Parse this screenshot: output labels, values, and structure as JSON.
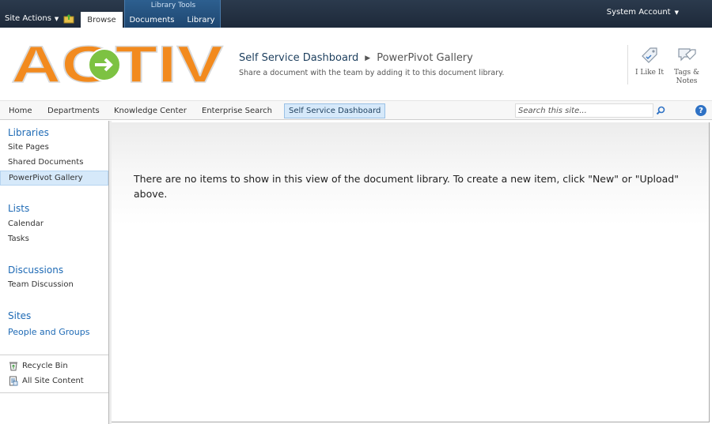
{
  "ribbon": {
    "site_actions": "Site Actions",
    "tabs": {
      "browse": "Browse",
      "documents": "Documents",
      "library": "Library"
    },
    "contextual_group": "Library Tools",
    "account": "System Account"
  },
  "header": {
    "logo_text": "AGTIV",
    "breadcrumb": {
      "site": "Self Service Dashboard",
      "current": "PowerPivot Gallery"
    },
    "description": "Share a document with the team by adding it to this document library.",
    "social": {
      "like": "I Like It",
      "tags_line1": "Tags &",
      "tags_line2": "Notes"
    }
  },
  "topnav": {
    "items": [
      "Home",
      "Departments",
      "Knowledge Center",
      "Enterprise Search",
      "Self Service Dashboard"
    ],
    "search_placeholder": "Search this site..."
  },
  "leftnav": {
    "libraries": {
      "heading": "Libraries",
      "items": [
        "Site Pages",
        "Shared Documents",
        "PowerPivot Gallery"
      ]
    },
    "lists": {
      "heading": "Lists",
      "items": [
        "Calendar",
        "Tasks"
      ]
    },
    "discussions": {
      "heading": "Discussions",
      "items": [
        "Team Discussion"
      ]
    },
    "sites": {
      "heading": "Sites",
      "items": [
        "People and Groups"
      ]
    },
    "utility": {
      "recycle_bin": "Recycle Bin",
      "all_site_content": "All Site Content"
    }
  },
  "main": {
    "empty_line1": "There are no items to show in this view of the document library. To create a new item, click \"New\" or \"Upload\"",
    "empty_line2": "above."
  },
  "colors": {
    "ribbon": "#1d2939",
    "accent": "#1e6ab5",
    "logo_orange": "#f28a1e",
    "logo_green": "#7dc242"
  }
}
